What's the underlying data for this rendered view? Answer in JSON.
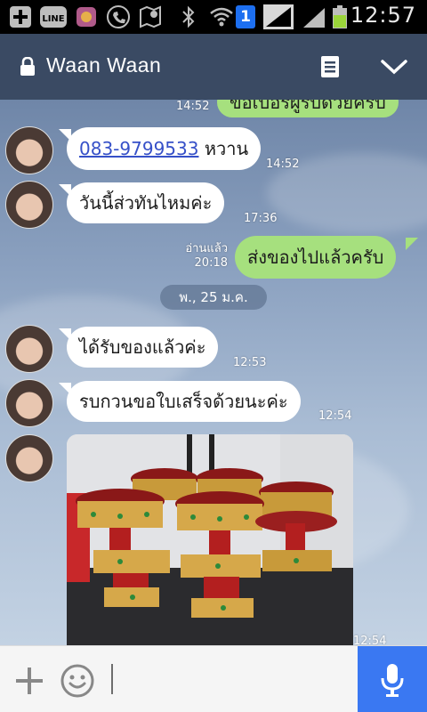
{
  "status_bar": {
    "time": "12:57",
    "icons": [
      "add-icon",
      "line-app-icon",
      "app-icon",
      "phone-icon",
      "maps-icon",
      "bluetooth-icon",
      "wifi-icon",
      "sim-1-icon",
      "signal-icon",
      "signal-2-icon",
      "battery-icon"
    ],
    "sim_badge": "1"
  },
  "header": {
    "title": "Waan Waan",
    "lock_icon": "lock-icon",
    "menu_icon": "notes-icon",
    "dropdown_icon": "chevron-down-icon",
    "background": "#3a4a63"
  },
  "messages": [
    {
      "direction": "out",
      "text": "ขอเบอร์ผู้รับด้วยครับ",
      "time": "14:52",
      "partial": true
    },
    {
      "direction": "in",
      "phone": "083-9799533",
      "text": "หวาน",
      "time": "14:52"
    },
    {
      "direction": "in",
      "text": "วันนี้ส่วทันไหมค่ะ",
      "time": "17:36"
    },
    {
      "direction": "out",
      "text": "ส่งของไปแล้วครับ",
      "time": "20:18",
      "status": "อ่านแล้ว"
    },
    {
      "direction": "in",
      "text": "ได้รับของแล้วค่ะ",
      "time": "12:53"
    },
    {
      "direction": "in",
      "text": "รบกวนขอใบเสร็จด้วยนะค่ะ",
      "time": "12:54"
    },
    {
      "direction": "in",
      "type": "image",
      "time": "12:54"
    }
  ],
  "date_separator": "พ., 25 ม.ค.",
  "input_bar": {
    "add_icon": "plus-icon",
    "emoji_icon": "smiley-icon",
    "mic_icon": "microphone-icon",
    "accent": "#3a78f2"
  },
  "colors": {
    "incoming_bubble": "#ffffff",
    "outgoing_bubble": "#a6e07e",
    "link": "#3650c8"
  }
}
